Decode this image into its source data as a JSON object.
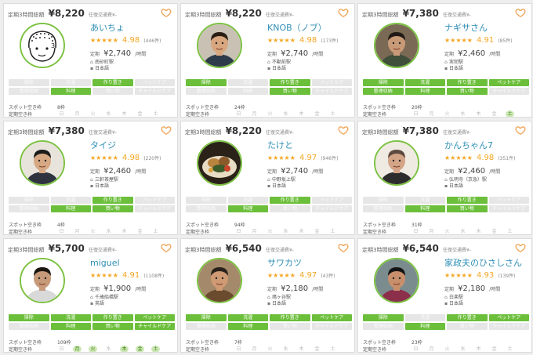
{
  "cards": [
    {
      "price_label": "定期3時間総額",
      "price": "¥8,220",
      "price_note": "往復交通費¥-",
      "name": "あいちょ",
      "stars": "★★★★★",
      "rating": "4.98",
      "reviews": "(446件)",
      "rate_label": "定期",
      "rate": "¥2,740",
      "rate_unit": "/時間",
      "station": "南砂町駅",
      "language": "日本語",
      "tags": [
        "掃除",
        "洗濯",
        "作り置き",
        "ペットケア",
        "整理収納",
        "料理",
        "買い物",
        "チャイルドケア"
      ],
      "tags_on": [
        false,
        false,
        true,
        false,
        false,
        true,
        false,
        false
      ],
      "spot_label": "スポット空き枠",
      "spot_value": "8枠",
      "regular_label": "定期空き枠",
      "days": [
        "日",
        "月",
        "火",
        "水",
        "木",
        "金",
        "土"
      ],
      "days_on": [
        false,
        false,
        false,
        false,
        false,
        false,
        false
      ],
      "avatar_style": "illustration",
      "colors": {
        "skin": "#ffffff",
        "hair": "#2b2b2b",
        "shirt": "#ffffff",
        "bg": "#ffffff"
      }
    },
    {
      "price_label": "定期3時間総額",
      "price": "¥8,220",
      "price_note": "往復交通費¥-",
      "name": "KNOB（ノブ）",
      "stars": "★★★★★",
      "rating": "4.98",
      "reviews": "(173件)",
      "rate_label": "定期",
      "rate": "¥2,740",
      "rate_unit": "/時間",
      "station": "不動前駅",
      "language": "日本語",
      "tags": [
        "掃除",
        "洗濯",
        "作り置き",
        "ペットケア",
        "整理収納",
        "料理",
        "買い物",
        "チャイルドケア"
      ],
      "tags_on": [
        true,
        false,
        true,
        false,
        false,
        false,
        true,
        false
      ],
      "spot_label": "スポット空き枠",
      "spot_value": "24枠",
      "regular_label": "定期空き枠",
      "days": [
        "日",
        "月",
        "火",
        "水",
        "木",
        "金",
        "土"
      ],
      "days_on": [
        false,
        false,
        false,
        false,
        false,
        false,
        false
      ],
      "avatar_style": "photo",
      "colors": {
        "skin": "#d9a77f",
        "hair": "#2a1d14",
        "shirt": "#2d3a4a",
        "bg": "#c9c1b4"
      }
    },
    {
      "price_label": "定期3時間総額",
      "price": "¥7,380",
      "price_note": "往復交通費¥-",
      "name": "ナギサさん",
      "stars": "★★★★★",
      "rating": "4.91",
      "reviews": "(85件)",
      "rate_label": "定期",
      "rate": "¥2,460",
      "rate_unit": "/時間",
      "station": "実籾駅",
      "language": "日本語",
      "tags": [
        "掃除",
        "洗濯",
        "作り置き",
        "ペットケア",
        "整理収納",
        "料理",
        "買い物",
        "チャイルドケア"
      ],
      "tags_on": [
        true,
        true,
        true,
        true,
        true,
        true,
        true,
        false
      ],
      "spot_label": "スポット空き枠",
      "spot_value": "20枠",
      "regular_label": "定期空き枠",
      "days": [
        "日",
        "月",
        "火",
        "水",
        "木",
        "金",
        "土"
      ],
      "days_on": [
        false,
        false,
        false,
        false,
        false,
        false,
        true
      ],
      "avatar_style": "photo",
      "colors": {
        "skin": "#c99a78",
        "hair": "#1f1a16",
        "shirt": "#3f4f3a",
        "bg": "#7a6a55"
      }
    },
    {
      "price_label": "定期3時間総額",
      "price": "¥7,380",
      "price_note": "往復交通費¥-",
      "name": "タイジ",
      "stars": "★★★★★",
      "rating": "4.98",
      "reviews": "(220件)",
      "rate_label": "定期",
      "rate": "¥2,460",
      "rate_unit": "/時間",
      "station": "三軒茶屋駅",
      "language": "日本語",
      "tags": [
        "掃除",
        "洗濯",
        "作り置き",
        "ペットケア",
        "整理収納",
        "料理",
        "買い物",
        "チャイルドケア"
      ],
      "tags_on": [
        false,
        false,
        true,
        false,
        false,
        true,
        true,
        false
      ],
      "spot_label": "スポット空き枠",
      "spot_value": "4枠",
      "regular_label": "定期空き枠",
      "days": [
        "日",
        "月",
        "火",
        "水",
        "木",
        "金",
        "土"
      ],
      "days_on": [
        false,
        false,
        false,
        false,
        false,
        false,
        false
      ],
      "avatar_style": "photo",
      "colors": {
        "skin": "#d6a883",
        "hair": "#1b1b1b",
        "shirt": "#2f3340",
        "bg": "#e8e4dc"
      }
    },
    {
      "price_label": "定期3時間総額",
      "price": "¥8,220",
      "price_note": "往復交通費¥-",
      "name": "たけと",
      "stars": "★★★★★",
      "rating": "4.97",
      "reviews": "(946件)",
      "rate_label": "定期",
      "rate": "¥2,740",
      "rate_unit": "/時間",
      "station": "中野坂上駅",
      "language": "日本語",
      "tags": [
        "掃除",
        "洗濯",
        "作り置き",
        "ペットケア",
        "整理収納",
        "料理",
        "買い物",
        "チャイルドケア"
      ],
      "tags_on": [
        false,
        false,
        true,
        false,
        false,
        true,
        false,
        false
      ],
      "spot_label": "スポット空き枠",
      "spot_value": "94枠",
      "regular_label": "定期空き枠",
      "days": [
        "日",
        "月",
        "火",
        "水",
        "木",
        "金",
        "土"
      ],
      "days_on": [
        false,
        false,
        false,
        false,
        false,
        false,
        false
      ],
      "avatar_style": "food",
      "colors": {
        "skin": "#b8843e",
        "hair": "#5a3a1a",
        "shirt": "#3d5c2a",
        "bg": "#2a2218"
      }
    },
    {
      "price_label": "定期3時間総額",
      "price": "¥7,380",
      "price_note": "往復交通費¥-",
      "name": "かんちゃん7",
      "stars": "★★★★★",
      "rating": "4.98",
      "reviews": "(351件)",
      "rate_label": "定期",
      "rate": "¥2,460",
      "rate_unit": "/時間",
      "station": "弘明寺（京急）駅",
      "language": "日本語",
      "tags": [
        "掃除",
        "洗濯",
        "作り置き",
        "ペットケア",
        "整理収納",
        "料理",
        "買い物",
        "チャイルドケア"
      ],
      "tags_on": [
        false,
        false,
        true,
        false,
        false,
        true,
        true,
        false
      ],
      "spot_label": "スポット空き枠",
      "spot_value": "31枠",
      "regular_label": "定期空き枠",
      "days": [
        "日",
        "月",
        "火",
        "水",
        "木",
        "金",
        "土"
      ],
      "days_on": [
        false,
        false,
        false,
        false,
        false,
        false,
        false
      ],
      "avatar_style": "photo",
      "colors": {
        "skin": "#d3a486",
        "hair": "#5c4a3e",
        "shirt": "#2c2c2c",
        "bg": "#efeae2"
      }
    },
    {
      "price_label": "定期3時間総額",
      "price": "¥5,700",
      "price_note": "往復交通費¥-",
      "name": "miguel",
      "stars": "★★★★★",
      "rating": "4.91",
      "reviews": "(1108件)",
      "rate_label": "定期",
      "rate": "¥1,900",
      "rate_unit": "/時間",
      "station": "千歳船橋駅",
      "language": "英語",
      "tags": [
        "掃除",
        "洗濯",
        "作り置き",
        "ペットケア",
        "整理収納",
        "料理",
        "買い物",
        "チャイルドケア"
      ],
      "tags_on": [
        true,
        true,
        true,
        true,
        false,
        true,
        true,
        true
      ],
      "spot_label": "スポット空き枠",
      "spot_value": "109枠",
      "regular_label": "定期空き枠",
      "days": [
        "日",
        "月",
        "火",
        "水",
        "木",
        "金",
        "土"
      ],
      "days_on": [
        false,
        true,
        true,
        false,
        true,
        true,
        true
      ],
      "avatar_style": "photo",
      "colors": {
        "skin": "#c79a7a",
        "hair": "#1c1610",
        "shirt": "#d9d9d9",
        "bg": "#ffffff"
      }
    },
    {
      "price_label": "定期3時間総額",
      "price": "¥6,540",
      "price_note": "往復交通費¥-",
      "name": "サワカツ",
      "stars": "★★★★★",
      "rating": "4.97",
      "reviews": "(43件)",
      "rate_label": "定期",
      "rate": "¥2,180",
      "rate_unit": "/時間",
      "station": "鳩ヶ谷駅",
      "language": "日本語",
      "tags": [
        "掃除",
        "洗濯",
        "作り置き",
        "ペットケア",
        "整理収納",
        "料理",
        "買い物",
        "チャイルドケア"
      ],
      "tags_on": [
        true,
        true,
        true,
        true,
        false,
        true,
        false,
        false
      ],
      "spot_label": "スポット空き枠",
      "spot_value": "7枠",
      "regular_label": "定期空き枠",
      "days": [
        "日",
        "月",
        "火",
        "水",
        "木",
        "金",
        "土"
      ],
      "days_on": [
        false,
        false,
        false,
        false,
        false,
        false,
        false
      ],
      "avatar_style": "photo",
      "colors": {
        "skin": "#cf9a74",
        "hair": "#2a211a",
        "shirt": "#6b4b2e",
        "bg": "#a48a6a"
      }
    },
    {
      "price_label": "定期3時間総額",
      "price": "¥6,540",
      "price_note": "往復交通費¥-",
      "name": "家政夫のひさしさん",
      "stars": "★★★★★",
      "rating": "4.93",
      "reviews": "(139件)",
      "rate_label": "定期",
      "rate": "¥2,180",
      "rate_unit": "/時間",
      "station": "白楽駅",
      "language": "日本語",
      "tags": [
        "掃除",
        "洗濯",
        "作り置き",
        "ペットケア",
        "整理収納",
        "料理",
        "買い物",
        "チャイルドケア"
      ],
      "tags_on": [
        true,
        false,
        true,
        true,
        false,
        true,
        false,
        false
      ],
      "spot_label": "スポット空き枠",
      "spot_value": "23枠",
      "regular_label": "定期空き枠",
      "days": [
        "日",
        "月",
        "火",
        "水",
        "木",
        "金",
        "土"
      ],
      "days_on": [
        false,
        false,
        false,
        false,
        false,
        false,
        false
      ],
      "avatar_style": "photo",
      "colors": {
        "skin": "#c88f6c",
        "hair": "#141414",
        "shirt": "#8b2f4a",
        "bg": "#7b8c8f"
      }
    }
  ],
  "colors": {
    "accent": "#6cbf3b",
    "link": "#2e8fb5",
    "star": "#f5a623",
    "heart": "#f0a050",
    "tag_off": "#e6e6e6"
  },
  "icons": {
    "favorite": "heart-outline-icon",
    "station": "station-icon",
    "language": "language-icon"
  }
}
